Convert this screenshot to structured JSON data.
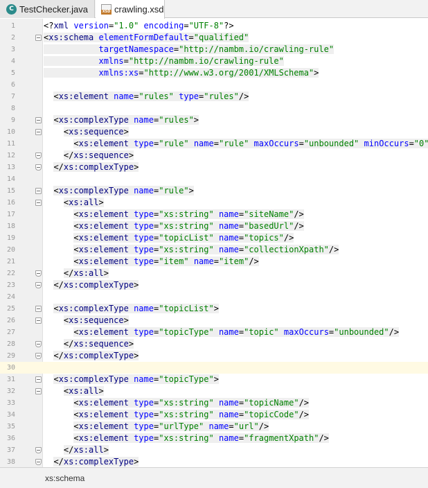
{
  "tabs": [
    {
      "label": "TestChecker.java",
      "icon": "java-class-icon",
      "active": false
    },
    {
      "label": "crawling.xsd",
      "icon": "xsd-file-icon",
      "active": true
    }
  ],
  "breadcrumb": "xs:schema",
  "current_line": 30,
  "lines": [
    {
      "n": "1",
      "text": "<?xml version=\"1.0\" encoding=\"UTF-8\"?>"
    },
    {
      "n": "2",
      "text": "<xs:schema elementFormDefault=\"qualified\""
    },
    {
      "n": "3",
      "text": "           targetNamespace=\"http://nambm.io/crawling-rule\""
    },
    {
      "n": "4",
      "text": "           xmlns=\"http://nambm.io/crawling-rule\""
    },
    {
      "n": "5",
      "text": "           xmlns:xs=\"http://www.w3.org/2001/XMLSchema\">"
    },
    {
      "n": "6",
      "text": ""
    },
    {
      "n": "7",
      "text": "  <xs:element name=\"rules\" type=\"rules\"/>"
    },
    {
      "n": "8",
      "text": ""
    },
    {
      "n": "9",
      "text": "  <xs:complexType name=\"rules\">"
    },
    {
      "n": "10",
      "text": "    <xs:sequence>"
    },
    {
      "n": "11",
      "text": "      <xs:element type=\"rule\" name=\"rule\" maxOccurs=\"unbounded\" minOccurs=\"0\"/>"
    },
    {
      "n": "12",
      "text": "    </xs:sequence>"
    },
    {
      "n": "13",
      "text": "  </xs:complexType>"
    },
    {
      "n": "14",
      "text": ""
    },
    {
      "n": "15",
      "text": "  <xs:complexType name=\"rule\">"
    },
    {
      "n": "16",
      "text": "    <xs:all>"
    },
    {
      "n": "17",
      "text": "      <xs:element type=\"xs:string\" name=\"siteName\"/>"
    },
    {
      "n": "18",
      "text": "      <xs:element type=\"xs:string\" name=\"basedUrl\"/>"
    },
    {
      "n": "19",
      "text": "      <xs:element type=\"topicList\" name=\"topics\"/>"
    },
    {
      "n": "20",
      "text": "      <xs:element type=\"xs:string\" name=\"collectionXpath\"/>"
    },
    {
      "n": "21",
      "text": "      <xs:element type=\"item\" name=\"item\"/>"
    },
    {
      "n": "22",
      "text": "    </xs:all>"
    },
    {
      "n": "23",
      "text": "  </xs:complexType>"
    },
    {
      "n": "24",
      "text": ""
    },
    {
      "n": "25",
      "text": "  <xs:complexType name=\"topicList\">"
    },
    {
      "n": "26",
      "text": "    <xs:sequence>"
    },
    {
      "n": "27",
      "text": "      <xs:element type=\"topicType\" name=\"topic\" maxOccurs=\"unbounded\"/>"
    },
    {
      "n": "28",
      "text": "    </xs:sequence>"
    },
    {
      "n": "29",
      "text": "  </xs:complexType>"
    },
    {
      "n": "30",
      "text": ""
    },
    {
      "n": "31",
      "text": "  <xs:complexType name=\"topicType\">"
    },
    {
      "n": "32",
      "text": "    <xs:all>"
    },
    {
      "n": "33",
      "text": "      <xs:element type=\"xs:string\" name=\"topicName\"/>"
    },
    {
      "n": "34",
      "text": "      <xs:element type=\"xs:string\" name=\"topicCode\"/>"
    },
    {
      "n": "35",
      "text": "      <xs:element type=\"urlType\" name=\"url\"/>"
    },
    {
      "n": "36",
      "text": "      <xs:element type=\"xs:string\" name=\"fragmentXpath\"/>"
    },
    {
      "n": "37",
      "text": "    </xs:all>"
    },
    {
      "n": "38",
      "text": "  </xs:complexType>"
    }
  ]
}
